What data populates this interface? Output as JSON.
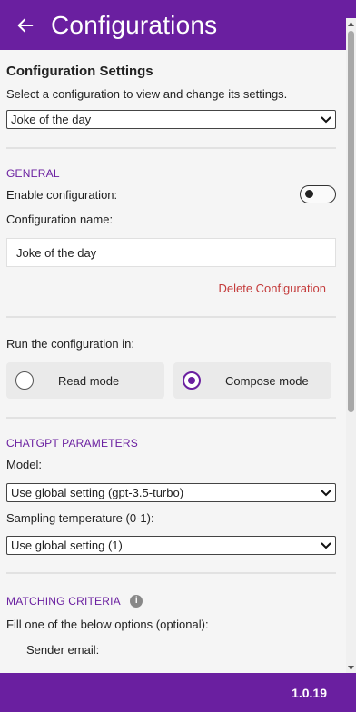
{
  "header": {
    "title": "Configurations",
    "back_icon": "arrow-left-icon"
  },
  "config_settings": {
    "title": "Configuration Settings",
    "description": "Select a configuration to view and change its settings.",
    "selected_config": "Joke of the day"
  },
  "general": {
    "heading": "GENERAL",
    "enable_label": "Enable configuration:",
    "enable_value": false,
    "name_label": "Configuration name:",
    "name_value": "Joke of the day",
    "delete_label": "Delete Configuration"
  },
  "run_mode": {
    "label": "Run the configuration in:",
    "options": [
      {
        "label": "Read mode",
        "checked": false
      },
      {
        "label": "Compose mode",
        "checked": true
      }
    ]
  },
  "chatgpt": {
    "heading": "CHATGPT PARAMETERS",
    "model_label": "Model:",
    "model_value": "Use global setting (gpt-3.5-turbo)",
    "temp_label": "Sampling temperature (0-1):",
    "temp_value": "Use global setting (1)"
  },
  "matching": {
    "heading": "MATCHING CRITERIA",
    "info_icon": "info-icon",
    "description": "Fill one of the below options (optional):",
    "sender_label": "Sender email:"
  },
  "footer": {
    "version": "1.0.19"
  },
  "colors": {
    "brand": "#6a1fa0",
    "danger": "#c43b3b"
  }
}
